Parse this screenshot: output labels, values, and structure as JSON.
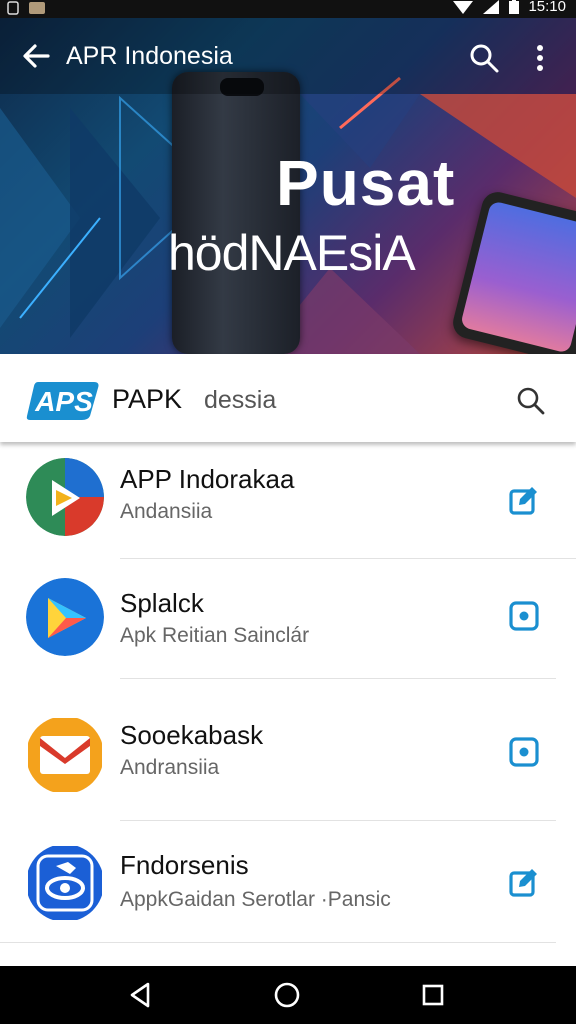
{
  "status_bar": {
    "time": "15:10"
  },
  "app_bar": {
    "title": "APR Indonesia"
  },
  "hero": {
    "line1": "Pusat",
    "line2": "hödNAEsiA"
  },
  "search_bar": {
    "logo_text": "APS",
    "brand": "PAPK",
    "query": "dessia"
  },
  "apps": [
    {
      "name": "APP Indorakaa",
      "subtitle": "Andansiia",
      "icon": "drive-triangle-icon",
      "action": "edit-icon"
    },
    {
      "name": "Splalck",
      "subtitle": "Apk Reitian Sainclár",
      "icon": "play-arrow-icon",
      "action": "install-icon"
    },
    {
      "name": "Sooekabask",
      "subtitle": "Andransiia",
      "icon": "mail-icon",
      "action": "install-icon"
    },
    {
      "name": "Fndorsenis",
      "subtitle": "AppkGaidan Serotlar ·Pansic",
      "icon": "shield-eye-icon",
      "action": "edit-icon"
    }
  ],
  "colors": {
    "accent": "#1a8fd0",
    "status_bar": "#111111",
    "nav_bar": "#000000"
  }
}
